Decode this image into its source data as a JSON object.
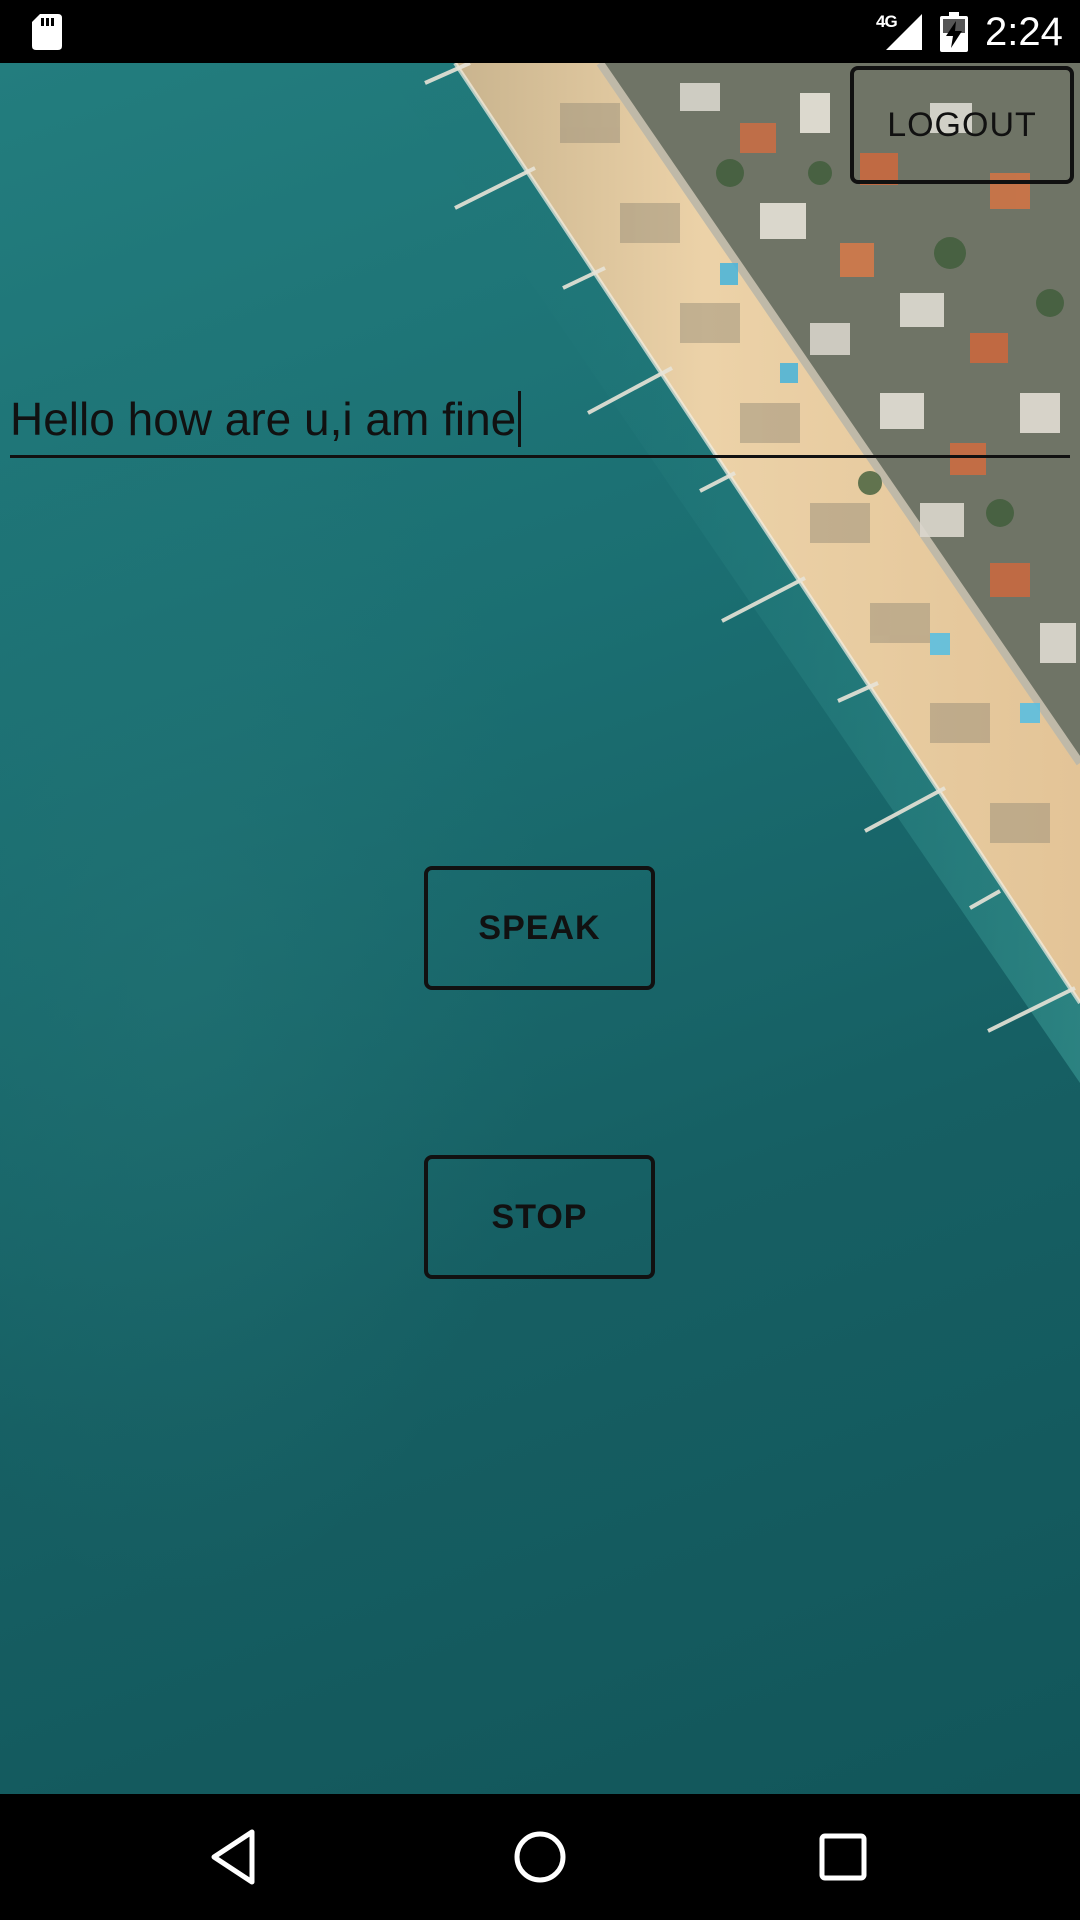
{
  "status_bar": {
    "network_type": "4G",
    "time": "2:24",
    "icons": [
      "sd-card-icon",
      "signal-icon",
      "battery-charging-icon"
    ]
  },
  "app": {
    "logout_label": "LOGOUT",
    "message_input_value": "Hello how are u,i am fine",
    "speak_label": "SPEAK",
    "stop_label": "STOP",
    "background": "aerial-beach-photo"
  },
  "nav_bar": {
    "icons": [
      "back-icon",
      "home-icon",
      "recents-icon"
    ]
  },
  "colors": {
    "status_bar_bg": "#000000",
    "nav_bar_bg": "#000000",
    "sea": "#1b6f72",
    "sand": "#e6c9a0",
    "outline": "#111111"
  }
}
